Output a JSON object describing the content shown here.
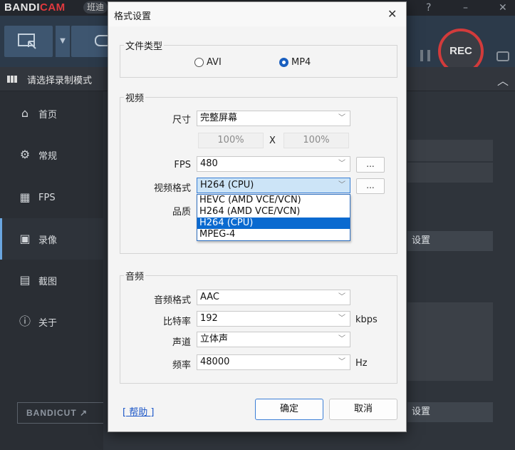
{
  "app": {
    "logo_main": "BANDI",
    "logo_accent": "CAM",
    "logo_tag": "班迪",
    "help_mark": "?",
    "minimize": "–",
    "close": "✕",
    "rec_label": "REC",
    "mode_label": "请选择录制模式",
    "bandicut_label": "BANDICUT",
    "bandicut_arrow": "↗",
    "settings_label_1": "设置",
    "settings_label_2": "设置",
    "brand_accent_color": "#e0393e"
  },
  "sidebar": {
    "items": [
      {
        "label": "首页",
        "icon": "home-icon"
      },
      {
        "label": "常规",
        "icon": "gear-icon"
      },
      {
        "label": "FPS",
        "icon": "fps-icon"
      },
      {
        "label": "录像",
        "icon": "video-icon"
      },
      {
        "label": "截图",
        "icon": "screenshot-icon"
      },
      {
        "label": "关于",
        "icon": "info-icon"
      }
    ],
    "active_index": 3
  },
  "dialog": {
    "title": "格式设置",
    "close": "✕",
    "file_type": {
      "label": "文件类型",
      "options": [
        "AVI",
        "MP4"
      ],
      "selected": "MP4"
    },
    "video": {
      "label": "视频",
      "size_label": "尺寸",
      "size_value": "完整屏幕",
      "width_pct": "100%",
      "x_label": "X",
      "height_pct": "100%",
      "fps_label": "FPS",
      "fps_value": "480",
      "fps_more": "...",
      "format_label": "视频格式",
      "format_value": "H264 (CPU)",
      "format_more": "...",
      "quality_label": "品质",
      "format_options": [
        "HEVC (AMD VCE/VCN)",
        "H264 (AMD VCE/VCN)",
        "H264 (CPU)",
        "MPEG-4"
      ],
      "format_selected_index": 2
    },
    "audio": {
      "label": "音频",
      "format_label": "音频格式",
      "format_value": "AAC",
      "bitrate_label": "比特率",
      "bitrate_value": "192",
      "bitrate_unit": "kbps",
      "channel_label": "声道",
      "channel_value": "立体声",
      "freq_label": "频率",
      "freq_value": "48000",
      "freq_unit": "Hz"
    },
    "help": "[ 帮助 ]",
    "ok": "确定",
    "cancel": "取消"
  }
}
